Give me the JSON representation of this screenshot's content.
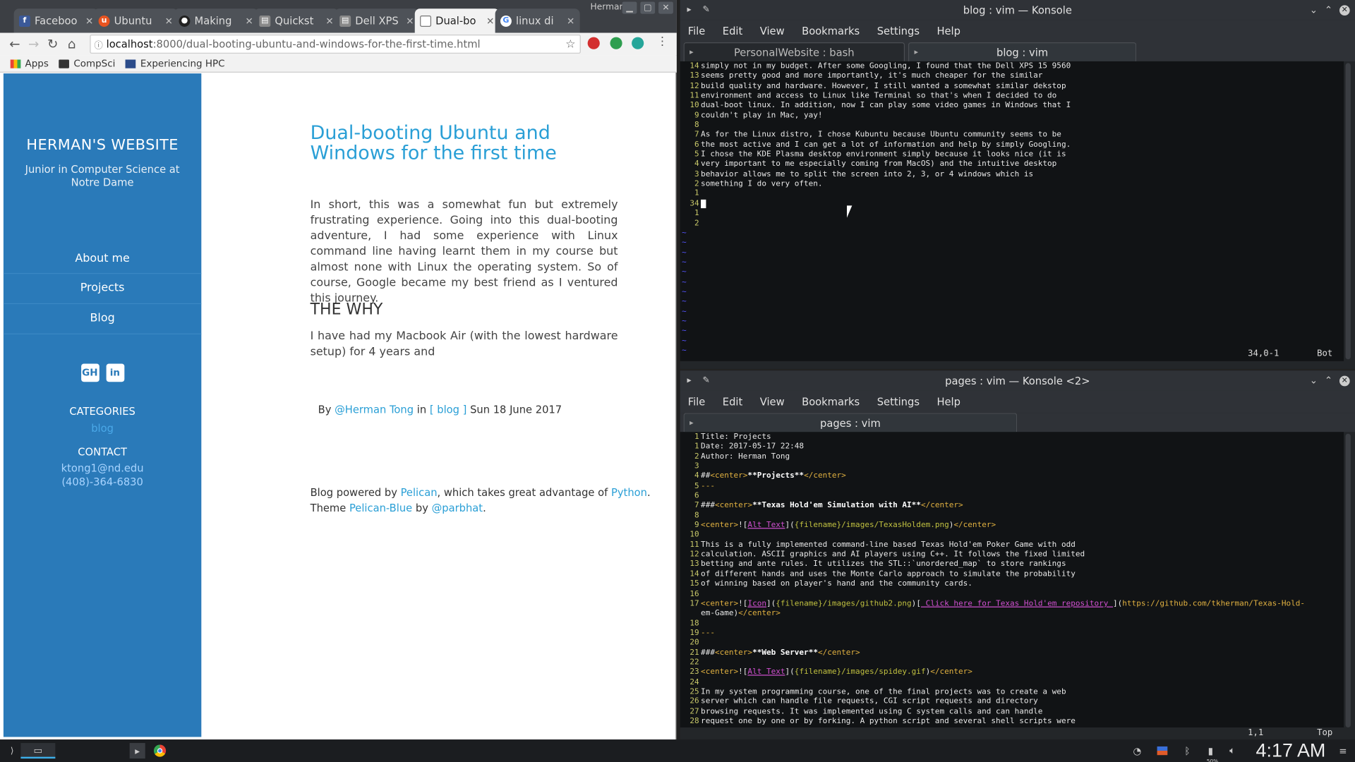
{
  "browser": {
    "tabs": [
      {
        "label": "Faceboo",
        "icon": "facebook-icon",
        "color": "#3b5998"
      },
      {
        "label": "Ubuntu",
        "icon": "ubuntu-icon",
        "color": "#e95420"
      },
      {
        "label": "Making",
        "icon": "github-icon",
        "color": "#222222"
      },
      {
        "label": "Quickst",
        "icon": "page-icon",
        "color": "#777777"
      },
      {
        "label": "Dell XPS",
        "icon": "page-icon",
        "color": "#777777"
      },
      {
        "label": "Dual-bo",
        "icon": "page-icon",
        "color": "#777777"
      },
      {
        "label": "linux di",
        "icon": "google-icon",
        "color": "#4285f4"
      }
    ],
    "user": "Herman",
    "url_host": "localhost",
    "url_rest": ":8000/dual-booting-ubuntu-and-windows-for-the-first-time.html",
    "bookmarks": [
      "Apps",
      "CompSci",
      "Experiencing HPC"
    ]
  },
  "site": {
    "title": "HERMAN'S WEBSITE",
    "subtitle": "Junior in Computer Science at Notre Dame",
    "nav": [
      "About me",
      "Projects",
      "Blog"
    ],
    "social": [
      "GH",
      "in"
    ],
    "categories_heading": "CATEGORIES",
    "category": "blog",
    "contact_heading": "CONTACT",
    "email": "ktong1@nd.edu",
    "phone": "(408)-364-6830"
  },
  "post": {
    "title": "Dual-booting Ubuntu and Windows for the first time",
    "intro": "In short, this was a somewhat fun but extremely frustrating experience. Going into this dual-booting adventure, I had some experience with Linux command line having learnt them in my course but almost none with Linux the operating system. So of course, Google became my best friend as I ventured this journey.",
    "heading": "THE WHY",
    "body": "I have had my Macbook Air (with the lowest hardware setup) for 4 years and",
    "by": "By",
    "author": "@Herman Tong",
    "in": "in",
    "category": "[ blog ]",
    "date": "Sun 18 June 2017",
    "footer1_a": "Blog powered by",
    "footer1_b": "Pelican",
    "footer1_c": ", which takes great advantage of",
    "footer1_d": "Python",
    "footer2_a": "Theme",
    "footer2_b": "Pelican-Blue",
    "footer2_c": "by",
    "footer2_d": "@parbhat"
  },
  "konsole1": {
    "title": "blog : vim — Konsole",
    "menu": [
      "File",
      "Edit",
      "View",
      "Bookmarks",
      "Settings",
      "Help"
    ],
    "tabs": [
      "PersonalWebsite : bash",
      "blog : vim"
    ],
    "lines": [
      [
        "14",
        "simply not in my budget. After some Googling, I found that the Dell XPS 15 9560"
      ],
      [
        "13",
        "seems pretty good and more importantly, it's much cheaper for the similar"
      ],
      [
        "12",
        "build quality and hardware. However, I still wanted a somewhat similar dekstop"
      ],
      [
        "11",
        "environment and access to Linux like Terminal so that's when I decided to do"
      ],
      [
        "10",
        "dual-boot linux. In addition, now I can play some video games in Windows that I"
      ],
      [
        "9",
        "couldn't play in Mac, yay!"
      ],
      [
        "8",
        ""
      ],
      [
        "7",
        "As for the Linux distro, I chose Kubuntu because Ubuntu community seems to be"
      ],
      [
        "6",
        "the most active and I can get a lot of information and help by simply Googling."
      ],
      [
        "5",
        "I chose the KDE Plasma desktop environment simply because it looks nice (it is"
      ],
      [
        "4",
        "very important to me especially coming from MacOS) and the intuitive desktop"
      ],
      [
        "3",
        "behavior allows me to split the screen into 2, 3, or 4 windows which is"
      ],
      [
        "2",
        "something I do very often."
      ],
      [
        "1",
        ""
      ],
      [
        "34",
        ""
      ],
      [
        "1",
        ""
      ],
      [
        "2",
        ""
      ]
    ],
    "tilde_count": 13,
    "position": "34,0-1",
    "scroll": "Bot"
  },
  "konsole2": {
    "title": "pages : vim — Konsole <2>",
    "menu": [
      "File",
      "Edit",
      "View",
      "Bookmarks",
      "Settings",
      "Help"
    ],
    "tab": "pages : vim",
    "lines": [
      [
        "1",
        "Title: Projects"
      ],
      [
        "1",
        "Date: 2017-05-17 22:48"
      ],
      [
        "2",
        "Author: Herman Tong"
      ],
      [
        "3",
        ""
      ],
      [
        "4",
        "##<center>**Projects**</center>"
      ],
      [
        "5",
        "---"
      ],
      [
        "6",
        ""
      ],
      [
        "7",
        "###<center>**Texas Hold'em Simulation with AI**</center>"
      ],
      [
        "8",
        ""
      ],
      [
        "9",
        "<center>![Alt Text]({filename}/images/TexasHoldem.png)</center>"
      ],
      [
        "10",
        ""
      ],
      [
        "11",
        "This is a fully implemented command-line based Texas Hold'em Poker Game with odd"
      ],
      [
        "12",
        "calculation. ASCII graphics and AI players using C++. It follows the fixed limited"
      ],
      [
        "13",
        "betting and ante rules. It utilizes the STL::`unordered_map` to store rankings"
      ],
      [
        "14",
        "of different hands and uses the Monte Carlo approach to simulate the probability"
      ],
      [
        "15",
        "of winning based on player's hand and the community cards."
      ],
      [
        "16",
        ""
      ],
      [
        "17",
        "<center>![Icon]({filename}/images/github2.png)[ Click here for Texas Hold'em repository ](https://github.com/tkherman/Texas-Hold-"
      ],
      [
        "",
        "em-Game)</center>"
      ],
      [
        "18",
        ""
      ],
      [
        "19",
        "---"
      ],
      [
        "20",
        ""
      ],
      [
        "21",
        "###<center>**Web Server**</center>"
      ],
      [
        "22",
        ""
      ],
      [
        "23",
        "<center>![Alt Text]({filename}/images/spidey.gif)</center>"
      ],
      [
        "24",
        ""
      ],
      [
        "25",
        "In my system programming course, one of the final projects was to create a web"
      ],
      [
        "26",
        "server which can handle file requests, CGI script requests and directory"
      ],
      [
        "27",
        "browsing requests. It was implemented using C system calls and can handle"
      ],
      [
        "28",
        "request one by one or by forking. A python script and several shell scripts were"
      ]
    ],
    "position": "1,1",
    "scroll": "Top"
  },
  "taskbar": {
    "clock": "4:17 AM",
    "battery": "50%"
  }
}
